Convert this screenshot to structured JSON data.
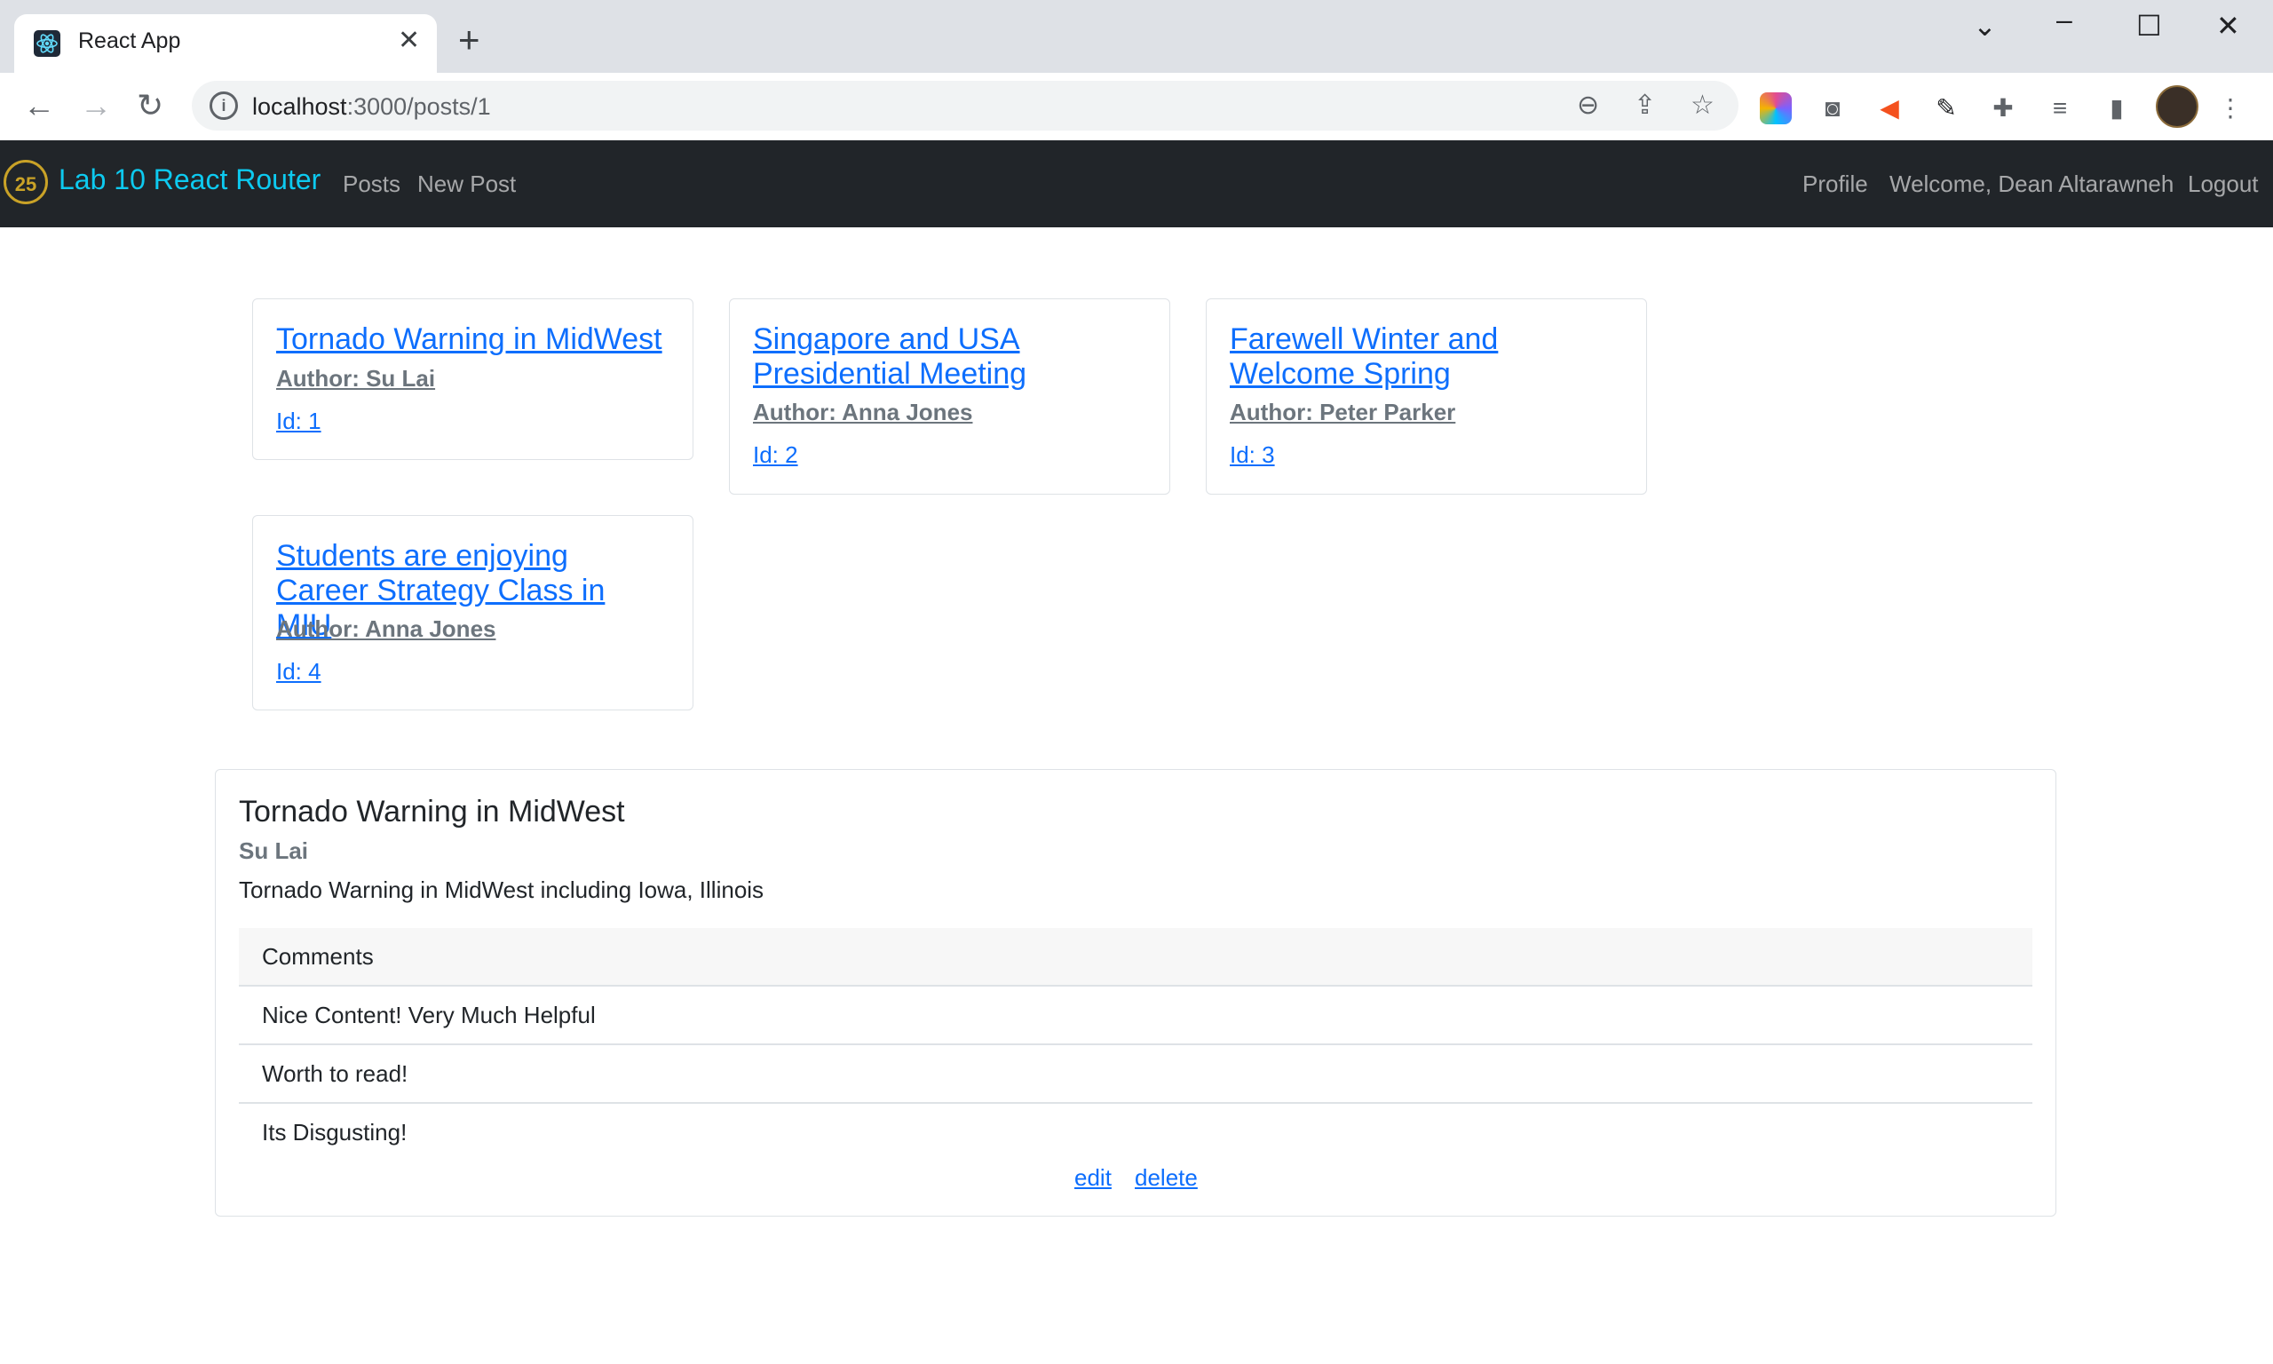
{
  "browser": {
    "tab_title": "React App",
    "url_host": "localhost",
    "url_rest": ":3000/posts/1"
  },
  "navbar": {
    "logo_text": "25",
    "brand": "Lab 10 React Router",
    "links": [
      "Posts",
      "New Post"
    ],
    "right": {
      "profile": "Profile",
      "welcome": "Welcome, Dean Altarawneh",
      "logout": "Logout"
    }
  },
  "posts": [
    {
      "title": "Tornado Warning in MidWest",
      "author": "Author: Su Lai",
      "id": "Id: 1"
    },
    {
      "title": "Singapore and USA Presidential Meeting",
      "author": "Author: Anna Jones",
      "id": "Id: 2"
    },
    {
      "title": "Farewell Winter and Welcome Spring",
      "author": "Author: Peter Parker",
      "id": "Id: 3"
    },
    {
      "title": "Students are enjoying Career Strategy Class in MIU",
      "author": "Author: Anna Jones",
      "id": "Id: 4"
    }
  ],
  "detail": {
    "title": "Tornado Warning in MidWest",
    "author": "Su Lai",
    "body": "Tornado Warning in MidWest including Iowa, Illinois",
    "comments_header": "Comments",
    "comments": [
      "Nice Content! Very Much Helpful",
      "Worth to read!",
      "Its Disgusting!"
    ],
    "edit": "edit",
    "delete": "delete"
  },
  "colors": {
    "navbar_bg": "#212529",
    "brand": "#0dcaf0",
    "link": "#0d6efd"
  }
}
